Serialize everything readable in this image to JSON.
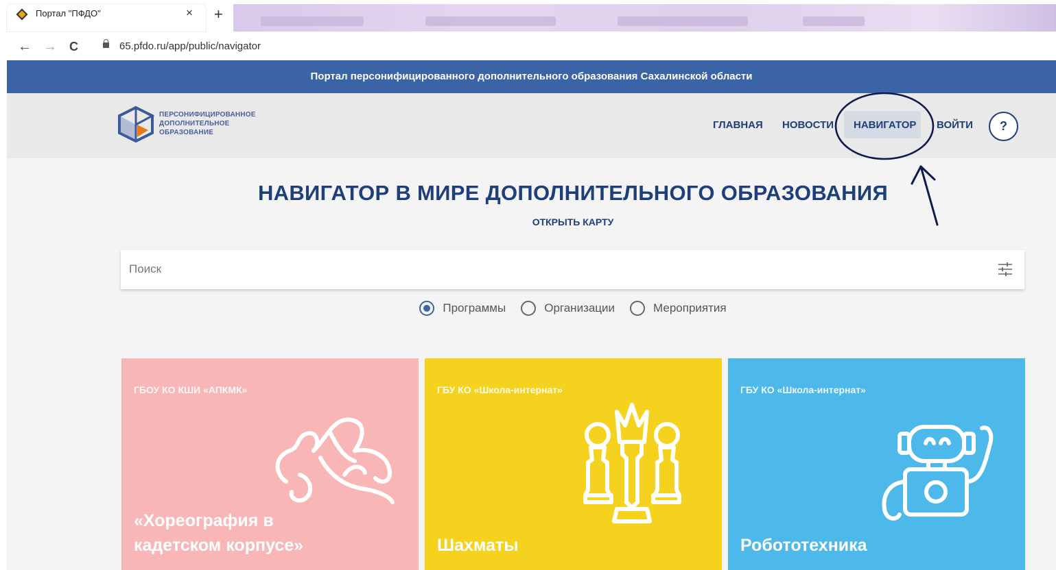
{
  "browser": {
    "tab_title": "Портал \"ПФДО\"",
    "tab_close": "×",
    "new_tab": "+",
    "back": "←",
    "forward": "→",
    "reload": "C",
    "url": "65.pfdo.ru/app/public/navigator"
  },
  "site": {
    "topbar_text": "Портал персонифицированного дополнительного образования Сахалинской области",
    "logo_line1": "ПЕРСОНИФИЦИРОВАННОЕ",
    "logo_line2": "ДОПОЛНИТЕЛЬНОЕ",
    "logo_line3": "ОБРАЗОВАНИЕ",
    "nav": {
      "home": "ГЛАВНАЯ",
      "news": "НОВОСТИ",
      "navigator": "НАВИГАТОР",
      "login": "ВОЙТИ",
      "help": "?"
    }
  },
  "main": {
    "title": "НАВИГАТОР В МИРЕ ДОПОЛНИТЕЛЬНОГО ОБРАЗОВАНИЯ",
    "map_link": "ОТКРЫТЬ КАРТУ",
    "search_placeholder": "Поиск",
    "search_type": {
      "options": [
        "Программы",
        "Организации",
        "Мероприятия"
      ],
      "selected": "Программы"
    },
    "cards": [
      {
        "org": "ГБОУ КО КШИ «АПКМК»",
        "title": "«Хореография в кадетском корпусе»",
        "color": "#f8b6b6",
        "icon": "dance-shoes-icon"
      },
      {
        "org": "ГБУ КО «Школа-интернат»",
        "title": "Шахматы",
        "color": "#f4d21e",
        "icon": "chess-icon"
      },
      {
        "org": "ГБУ КО «Школа-интернат»",
        "title": "Робототехника",
        "color": "#4db8ea",
        "icon": "robot-icon"
      }
    ]
  },
  "colors": {
    "primary": "#3a64a6",
    "dark_blue": "#1f3f7a",
    "header_bg": "#e9e9e9",
    "annotation": "#101850"
  }
}
